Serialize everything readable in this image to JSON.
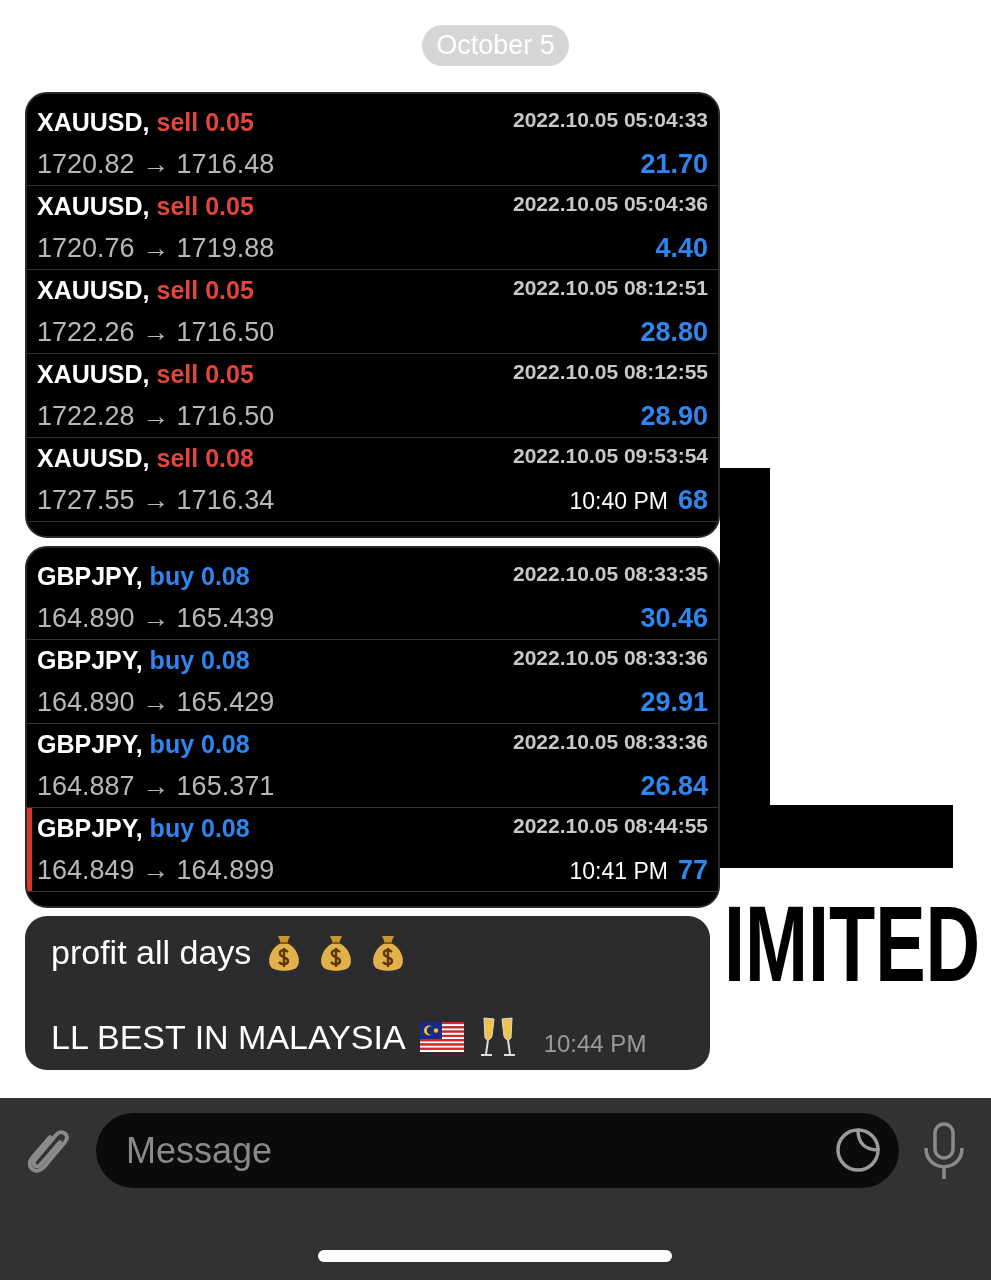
{
  "date_pill": "October 5",
  "messages": [
    {
      "kind": "trades",
      "time": "10:40 PM",
      "trades": [
        {
          "symbol": "XAUUSD,",
          "order": "sell 0.05",
          "color": "#e2453a",
          "prices": "1720.82 → 1716.48",
          "datetime": "2022.10.05 05:04:33",
          "profit": "21.70",
          "highlighted": false
        },
        {
          "symbol": "XAUUSD,",
          "order": "sell 0.05",
          "color": "#e2453a",
          "prices": "1720.76 → 1719.88",
          "datetime": "2022.10.05 05:04:36",
          "profit": "4.40",
          "highlighted": false
        },
        {
          "symbol": "XAUUSD,",
          "order": "sell 0.05",
          "color": "#e2453a",
          "prices": "1722.26 → 1716.50",
          "datetime": "2022.10.05 08:12:51",
          "profit": "28.80",
          "highlighted": false
        },
        {
          "symbol": "XAUUSD,",
          "order": "sell 0.05",
          "color": "#e2453a",
          "prices": "1722.28 → 1716.50",
          "datetime": "2022.10.05 08:12:55",
          "profit": "28.90",
          "highlighted": false
        },
        {
          "symbol": "XAUUSD,",
          "order": "sell 0.08",
          "color": "#e2453a",
          "prices": "1727.55 → 1716.34",
          "datetime": "2022.10.05 09:53:54",
          "profit": "68",
          "highlighted": false
        }
      ]
    },
    {
      "kind": "trades",
      "time": "10:41 PM",
      "trades": [
        {
          "symbol": "GBPJPY,",
          "order": "buy 0.08",
          "color": "#2f86f0",
          "prices": "164.890 → 165.439",
          "datetime": "2022.10.05 08:33:35",
          "profit": "30.46",
          "highlighted": false
        },
        {
          "symbol": "GBPJPY,",
          "order": "buy 0.08",
          "color": "#2f86f0",
          "prices": "164.890 → 165.429",
          "datetime": "2022.10.05 08:33:36",
          "profit": "29.91",
          "highlighted": false
        },
        {
          "symbol": "GBPJPY,",
          "order": "buy 0.08",
          "color": "#2f86f0",
          "prices": "164.887 → 165.371",
          "datetime": "2022.10.05 08:33:36",
          "profit": "26.84",
          "highlighted": false
        },
        {
          "symbol": "GBPJPY,",
          "order": "buy 0.08",
          "color": "#2f86f0",
          "prices": "164.849 → 164.899",
          "datetime": "2022.10.05 08:44:55",
          "profit": "77",
          "highlighted": true
        }
      ]
    },
    {
      "kind": "text",
      "time": "10:44 PM",
      "lines": [
        "profit all days",
        "LL BEST IN MALAYSIA"
      ]
    }
  ],
  "wallpaper_text": "IMITED",
  "composer": {
    "placeholder": "Message"
  }
}
